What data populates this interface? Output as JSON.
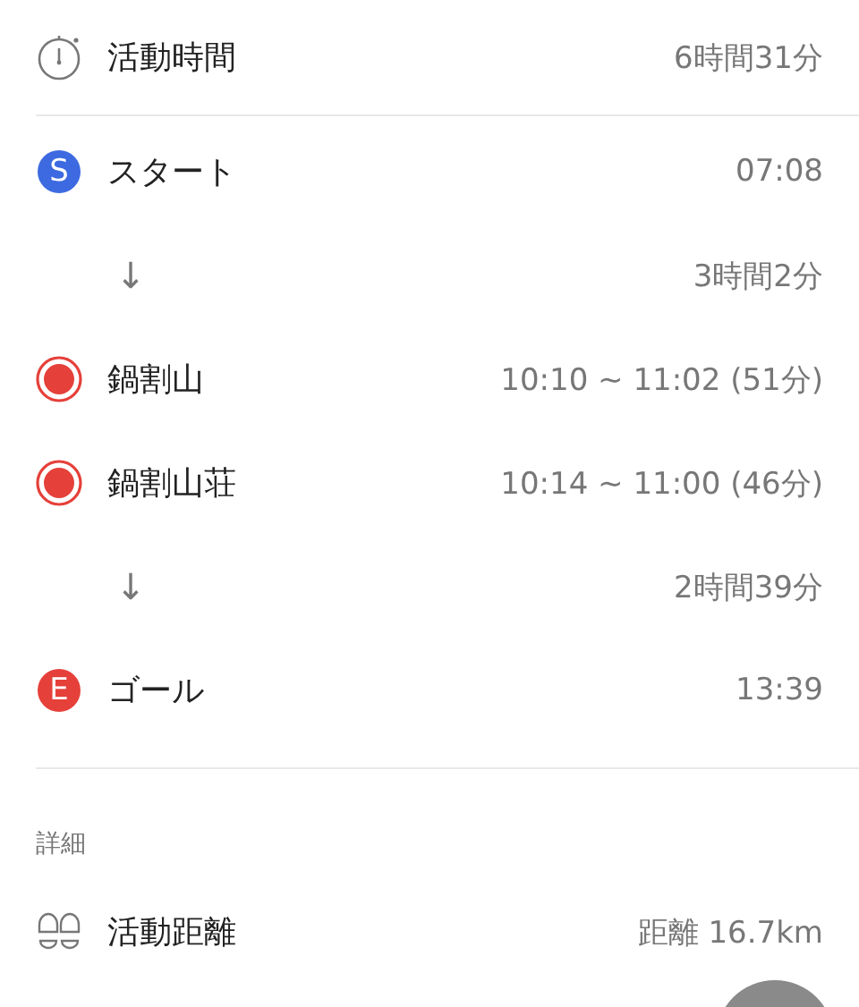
{
  "summary": {
    "label": "活動時間",
    "value": "6時間31分"
  },
  "timeline": [
    {
      "kind": "lettered",
      "letter": "S",
      "color": "#3d6ae0",
      "label": "スタート",
      "value": "07:08"
    },
    {
      "kind": "duration",
      "arrow": "↓",
      "value": "3時間2分"
    },
    {
      "kind": "ringed",
      "color": "#e5403a",
      "label": "鍋割山",
      "value": "10:10 ~ 11:02 (51分)"
    },
    {
      "kind": "ringed",
      "color": "#e5403a",
      "label": "鍋割山荘",
      "value": "10:14 ~ 11:00 (46分)"
    },
    {
      "kind": "duration",
      "arrow": "↓",
      "value": "2時間39分"
    },
    {
      "kind": "lettered",
      "letter": "E",
      "color": "#e5403a",
      "label": "ゴール",
      "value": "13:39"
    }
  ],
  "details": {
    "header": "詳細",
    "rows": [
      {
        "label": "活動距離",
        "value": "距離 16.7km"
      }
    ]
  }
}
